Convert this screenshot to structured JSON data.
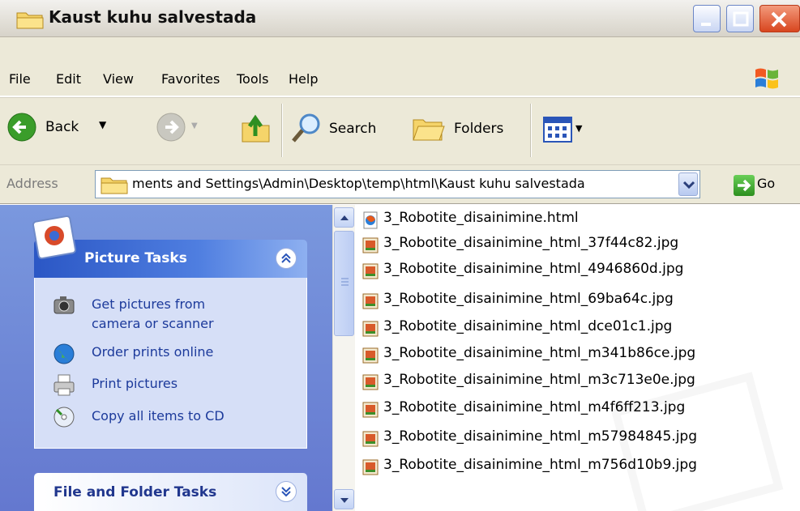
{
  "window": {
    "title": "Kaust kuhu salvestada"
  },
  "menu": [
    "File",
    "Edit",
    "View",
    "Favorites",
    "Tools",
    "Help"
  ],
  "toolbar": {
    "back_label": "Back",
    "search_label": "Search",
    "folders_label": "Folders"
  },
  "address": {
    "label": "Address",
    "value": "ments and Settings\\Admin\\Desktop\\temp\\html\\Kaust kuhu salvestada",
    "go_label": "Go"
  },
  "picture_tasks": {
    "title": "Picture Tasks",
    "items": [
      {
        "line1": "Get pictures from",
        "line2": "camera or scanner",
        "icon": "camera-icon"
      },
      {
        "line1": "Order prints online",
        "icon": "globe-icon"
      },
      {
        "line1": "Print pictures",
        "icon": "printer-icon"
      },
      {
        "line1": "Copy all items to CD",
        "icon": "cd-icon"
      }
    ]
  },
  "file_folder_tasks": {
    "title": "File and Folder Tasks"
  },
  "files": [
    {
      "name": "3_Robotite_disainimine.html",
      "icon": "html-file-icon"
    },
    {
      "name": "3_Robotite_disainimine_html_37f44c82.jpg",
      "icon": "jpg-file-icon"
    },
    {
      "name": "3_Robotite_disainimine_html_4946860d.jpg",
      "icon": "jpg-file-icon"
    },
    {
      "name": "3_Robotite_disainimine_html_69ba64c.jpg",
      "icon": "jpg-file-icon"
    },
    {
      "name": "3_Robotite_disainimine_html_dce01c1.jpg",
      "icon": "jpg-file-icon"
    },
    {
      "name": "3_Robotite_disainimine_html_m341b86ce.jpg",
      "icon": "jpg-file-icon"
    },
    {
      "name": "3_Robotite_disainimine_html_m3c713e0e.jpg",
      "icon": "jpg-file-icon"
    },
    {
      "name": "3_Robotite_disainimine_html_m4f6ff213.jpg",
      "icon": "jpg-file-icon"
    },
    {
      "name": "3_Robotite_disainimine_html_m57984845.jpg",
      "icon": "jpg-file-icon"
    },
    {
      "name": "3_Robotite_disainimine_html_m756d10b9.jpg",
      "icon": "jpg-file-icon"
    }
  ]
}
